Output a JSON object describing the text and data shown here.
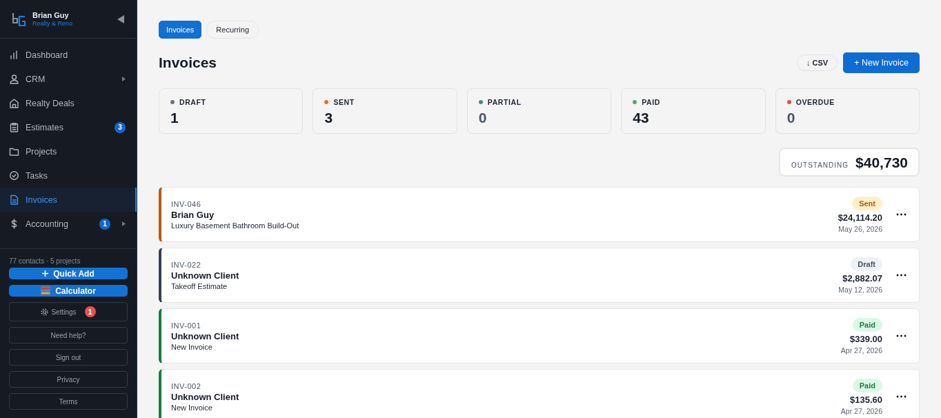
{
  "brand": {
    "name": "Brian Guy",
    "tagline": "Realty & Reno"
  },
  "sidebar": {
    "items": [
      {
        "label": "Dashboard",
        "selected": false,
        "expandable": false
      },
      {
        "label": "CRM",
        "selected": false,
        "expandable": true
      },
      {
        "label": "Realty Deals",
        "selected": false,
        "expandable": false
      },
      {
        "label": "Estimates",
        "selected": false,
        "badge": "3",
        "expandable": false
      },
      {
        "label": "Projects",
        "selected": false,
        "expandable": false
      },
      {
        "label": "Tasks",
        "selected": false,
        "expandable": false
      },
      {
        "label": "Invoices",
        "selected": true,
        "expandable": false
      },
      {
        "label": "Accounting",
        "selected": false,
        "badge": "1",
        "expandable": true
      }
    ],
    "summary": "77 contacts · 5 projects",
    "quick_add": "Quick Add",
    "calculator": "Calculator",
    "settings": {
      "label": "Settings",
      "badge": "1"
    },
    "links": [
      "Need help?",
      "Sign out",
      "Privacy",
      "Terms"
    ]
  },
  "tabs": [
    {
      "label": "Invoices",
      "selected": true
    },
    {
      "label": "Recurring",
      "selected": false
    }
  ],
  "title": "Invoices",
  "actions": {
    "csv": "↓ CSV",
    "new": "+ New Invoice"
  },
  "stats": [
    {
      "label": "DRAFT",
      "value": "1",
      "color": "#6b7280"
    },
    {
      "label": "SENT",
      "value": "3",
      "color": "#c97a43"
    },
    {
      "label": "PARTIAL",
      "value": "0",
      "color": "#4f8a84"
    },
    {
      "label": "PAID",
      "value": "43",
      "color": "#5aa56e"
    },
    {
      "label": "OVERDUE",
      "value": "0",
      "color": "#d0574f"
    }
  ],
  "outstanding": {
    "label": "OUTSTANDING",
    "value": "$40,730"
  },
  "invoices": [
    {
      "number": "INV-046",
      "client": "Brian Guy",
      "description": "Luxury Basement Bathroom Build-Out",
      "status": "Sent",
      "kind": "sent",
      "amount": "$24,114.20",
      "date": "May 26, 2026"
    },
    {
      "number": "INV-022",
      "client": "Unknown Client",
      "description": "Takeoff Estimate",
      "status": "Draft",
      "kind": "draft",
      "amount": "$2,882.07",
      "date": "May 12, 2026"
    },
    {
      "number": "INV-001",
      "client": "Unknown Client",
      "description": "New Invoice",
      "status": "Paid",
      "kind": "paid",
      "amount": "$339.00",
      "date": "Apr 27, 2026"
    },
    {
      "number": "INV-002",
      "client": "Unknown Client",
      "description": "New Invoice",
      "status": "Paid",
      "kind": "paid",
      "amount": "$135.60",
      "date": "Apr 27, 2026"
    }
  ]
}
